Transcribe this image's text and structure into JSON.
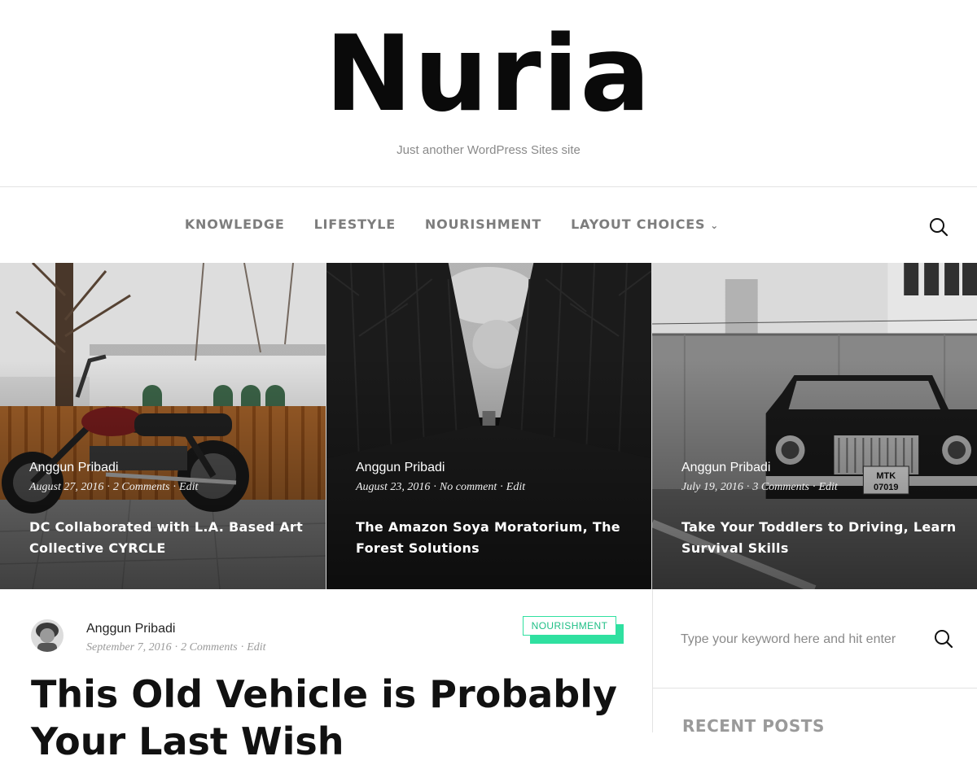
{
  "site": {
    "title": "Nuria",
    "tagline": "Just another WordPress Sites site"
  },
  "nav": {
    "items": [
      {
        "label": "KNOWLEDGE"
      },
      {
        "label": "LIFESTYLE"
      },
      {
        "label": "NOURISHMENT"
      },
      {
        "label": "LAYOUT CHOICES",
        "has_dropdown": true
      }
    ],
    "search_icon": "search-icon"
  },
  "featured": [
    {
      "author": "Anggun Pribadi",
      "date": "August 27, 2016",
      "comments": "2 Comments",
      "edit": "Edit",
      "title": "DC Collaborated with L.A. Based Art Collective CYRCLE",
      "image": "motorcycle"
    },
    {
      "author": "Anggun Pribadi",
      "date": "August 23, 2016",
      "comments": "No comment",
      "edit": "Edit",
      "title": "The Amazon Soya Moratorium, The Forest Solutions",
      "image": "forest-avenue"
    },
    {
      "author": "Anggun Pribadi",
      "date": "July 19, 2016",
      "comments": "3 Comments",
      "edit": "Edit",
      "title": "Take Your Toddlers to Driving, Learn Survival Skills",
      "image": "vintage-car",
      "plate": "MTK 07019"
    }
  ],
  "post": {
    "author": "Anggun Pribadi",
    "date": "September 7, 2016",
    "comments": "2 Comments",
    "edit": "Edit",
    "category": "NOURISHMENT",
    "title": "This Old Vehicle is Probably Your Last Wish"
  },
  "sidebar": {
    "search_placeholder": "Type your keyword here and hit enter",
    "recent_posts_title": "RECENT POSTS"
  },
  "colors": {
    "accent": "#2fe0a0",
    "nav_text": "#7d7d7d",
    "meta_text": "#9a9a9a"
  }
}
